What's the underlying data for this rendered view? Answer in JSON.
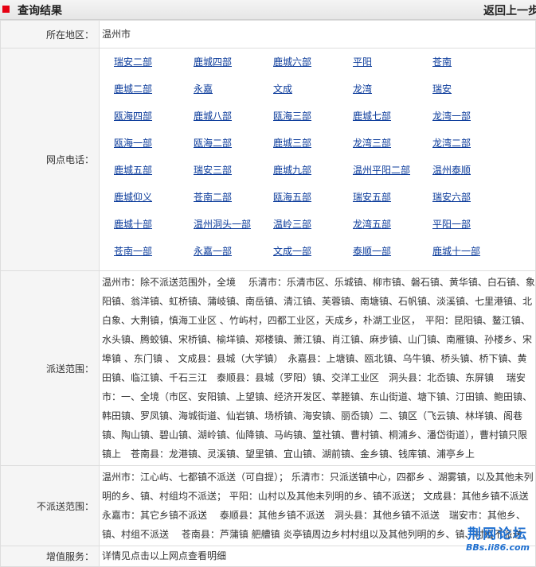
{
  "header": {
    "title": "查询结果",
    "back_label": "返回上一步"
  },
  "rows": {
    "region": {
      "label": "所在地区：",
      "value": "温州市"
    },
    "outlets": {
      "label": "网点电话：",
      "items": [
        "瑞安二部",
        "鹿城四部",
        "鹿城六部",
        "平阳",
        "苍南",
        "鹿城二部",
        "永嘉",
        "文成",
        "龙湾",
        "瑞安",
        "瓯海四部",
        "鹿城八部",
        "瓯海三部",
        "鹿城七部",
        "龙湾一部",
        "瓯海一部",
        "瓯海二部",
        "鹿城三部",
        "龙湾三部",
        "龙湾二部",
        "鹿城五部",
        "瑞安三部",
        "鹿城九部",
        "温州平阳二部",
        "温州泰顺",
        "鹿城仰义",
        "苍南二部",
        "瓯海五部",
        "瑞安五部",
        "瑞安六部",
        "鹿城十部",
        "温州洞头一部",
        "温岭三部",
        "龙湾五部",
        "平阳一部",
        "苍南一部",
        "永嘉一部",
        "文成一部",
        "泰顺一部",
        "鹿城十一部"
      ]
    },
    "delivery": {
      "label": "派送范围：",
      "text": "温州市：除不派送范围外，全境　 乐清市：乐清市区、乐城镇、柳市镇、磐石镇、黄华镇、白石镇、象阳镇、翁洋镇、虹桥镇、蒲岐镇、南岳镇、清江镇、芙蓉镇、南塘镇、石帆镇、淡溪镇、七里港镇、北白象、大荆镇，慎海工业区 、竹屿村，四都工业区，天成乡，朴湖工业区，　平阳：昆阳镇、鳌江镇、水头镇、腾蛟镇、宋桥镇、榆垟镇、郑楼镇、萧江镇、肖江镇、麻步镇、山门镇、南雁镇、孙楼乡、宋埠镇 、东门镇 、 文成县：县城（大学镇）　永嘉县：上塘镇、瓯北镇、乌牛镇、桥头镇、桥下镇、黄田镇、临江镇、千石三江　泰顺县：县城（罗阳）镇、交洋工业区　洞头县：北岙镇、东屏镇　 瑞安市：一、全境（市区、安阳镇、上望镇、经济开发区、莘塍镇、东山街道、塘下镇、汀田镇、鲍田镇、韩田镇、罗凤镇、海城街道、仙岩镇、场桥镇、海安镇、丽岙镇）二、镇区（飞云镇、林垟镇、阁巷镇、陶山镇、碧山镇、湖岭镇、仙降镇、马屿镇、篁社镇、曹村镇、桐浦乡、潘岱街道），曹村镇只限镇上　苍南县：龙港镇、灵溪镇、望里镇、宜山镇、湖前镇、金乡镇、钱库镇、浦亭乡上"
    },
    "nodelivery": {
      "label": "不派送范围：",
      "text": "温州市：江心屿、七都镇不派送（可自提）； 乐清市：只派送镇中心，四都乡 、湖雾镇，以及其他未列明的乡、镇、村组均不派送； 平阳：山村以及其他未列明的乡、镇不派送； 文成县：其他乡镇不派送　永嘉市：其它乡镇不派送　 泰顺县：其他乡镇不派送　洞头县：其他乡镇不派送　瑞安市：其他乡、镇、村组不派送　 苍南县：芦蒲镇 舥艚镇 炎亭镇周边乡村村组以及其他列明的乡、镇、村组不派送"
    },
    "value_added": {
      "label": "增值服务：",
      "value": "详情见点击以上网点查看明细"
    }
  },
  "watermark": {
    "name": "荆网论坛",
    "url": "BBs.ii86.com"
  },
  "colors": {
    "link": "#0a3a9a",
    "label_bg": "#f5f5f5",
    "border": "#dddddd",
    "bullet": "#e60012"
  }
}
